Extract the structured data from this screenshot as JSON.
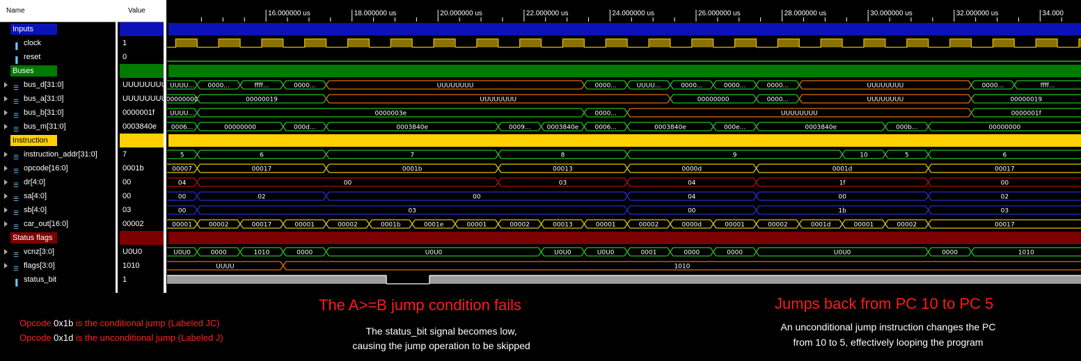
{
  "columns": {
    "name": "Name",
    "value": "Value"
  },
  "timeline": {
    "t0": 13.7,
    "t1": 34.95,
    "ticks": [
      "16.000000 us",
      "18.000000 us",
      "20.000000 us",
      "22.000000 us",
      "24.000000 us",
      "26.000000 us",
      "28.000000 us",
      "30.000000 us",
      "32.000000 us",
      "34.000"
    ],
    "tick_times": [
      16,
      18,
      20,
      22,
      24,
      26,
      28,
      30,
      32,
      34
    ]
  },
  "colors": {
    "inputs": "#0b12b8",
    "buses": "#007a00",
    "instruction": "#ffd000",
    "status": "#7d0000",
    "yellow": "#e6c100",
    "gold": "#c8a020",
    "green": "#21c421",
    "red": "#b01010",
    "blue": "#2030d0",
    "orange": "#e07000",
    "gray": "#9c9c9c",
    "clockFill": "#8a7100"
  },
  "signals": [
    {
      "name": "Inputs",
      "value": "",
      "kind": "group",
      "color": "#0b12b8"
    },
    {
      "name": "clock",
      "value": "1",
      "kind": "bit",
      "icon": "bit-icon"
    },
    {
      "name": "reset",
      "value": "0",
      "kind": "bit",
      "icon": "bit-icon"
    },
    {
      "name": "Buses",
      "value": "",
      "kind": "group",
      "color": "#007a00"
    },
    {
      "name": "bus_d[31:0]",
      "value": "UUUUUUUU",
      "kind": "bus",
      "icon": "bus-icon"
    },
    {
      "name": "bus_a[31:0]",
      "value": "UUUUUUUU",
      "kind": "bus",
      "icon": "bus-icon"
    },
    {
      "name": "bus_b[31:0]",
      "value": "0000001f",
      "kind": "bus",
      "icon": "bus-icon"
    },
    {
      "name": "bus_m[31:0]",
      "value": "0003840e",
      "kind": "bus",
      "icon": "bus-icon"
    },
    {
      "name": "Instruction",
      "value": "",
      "kind": "group",
      "color": "#ffd000"
    },
    {
      "name": "instruction_addr[31:0]",
      "value": "7",
      "kind": "bus",
      "icon": "bus-icon"
    },
    {
      "name": "opcode[16:0]",
      "value": "0001b",
      "kind": "bus",
      "icon": "bus-icon"
    },
    {
      "name": "dr[4:0]",
      "value": "00",
      "kind": "bus",
      "icon": "bus-icon"
    },
    {
      "name": "sa[4:0]",
      "value": "00",
      "kind": "bus",
      "icon": "bus-icon"
    },
    {
      "name": "sb[4:0]",
      "value": "03",
      "kind": "bus",
      "icon": "bus-icon"
    },
    {
      "name": "car_out[16:0]",
      "value": "00002",
      "kind": "bus",
      "icon": "bus-icon"
    },
    {
      "name": "Status flags",
      "value": "",
      "kind": "group",
      "color": "#7d0000"
    },
    {
      "name": "vcnz[3:0]",
      "value": "U0U0",
      "kind": "bus",
      "icon": "bus-icon"
    },
    {
      "name": "flags[3:0]",
      "value": "1010",
      "kind": "bus",
      "icon": "bus-icon"
    },
    {
      "name": "status_bit",
      "value": "1",
      "kind": "bit",
      "icon": "bit-icon"
    }
  ],
  "waves": {
    "bus_d": [
      {
        "t": 13.7,
        "v": "UUUU...",
        "c": "#21c421"
      },
      {
        "t": 14.4,
        "v": "0000...",
        "c": "#21c421"
      },
      {
        "t": 15.4,
        "v": "ffff...",
        "c": "#21c421"
      },
      {
        "t": 16.4,
        "v": "0000...",
        "c": "#21c421"
      },
      {
        "t": 17.4,
        "v": "UUUUUUUU",
        "c": "#e07000"
      },
      {
        "t": 23.4,
        "v": "0000...",
        "c": "#21c421"
      },
      {
        "t": 24.4,
        "v": "UUUU...",
        "c": "#21c421"
      },
      {
        "t": 25.4,
        "v": "0000...",
        "c": "#21c421"
      },
      {
        "t": 26.4,
        "v": "0000...",
        "c": "#21c421"
      },
      {
        "t": 27.4,
        "v": "0000...",
        "c": "#21c421"
      },
      {
        "t": 28.4,
        "v": "UUUUUUUU",
        "c": "#e07000"
      },
      {
        "t": 32.4,
        "v": "0000...",
        "c": "#21c421"
      },
      {
        "t": 33.4,
        "v": "ffff...",
        "c": "#21c421"
      }
    ],
    "bus_a": [
      {
        "t": 13.7,
        "v": "00000000",
        "c": "#21c421"
      },
      {
        "t": 14.4,
        "v": "00000019",
        "c": "#21c421"
      },
      {
        "t": 17.4,
        "v": "UUUUUUUU",
        "c": "#e07000"
      },
      {
        "t": 25.4,
        "v": "00000000",
        "c": "#21c421"
      },
      {
        "t": 27.4,
        "v": "0000...",
        "c": "#21c421"
      },
      {
        "t": 28.4,
        "v": "UUUUUUUU",
        "c": "#e07000"
      },
      {
        "t": 32.4,
        "v": "00000019",
        "c": "#21c421"
      }
    ],
    "bus_b": [
      {
        "t": 13.7,
        "v": "UUUU...",
        "c": "#21c421"
      },
      {
        "t": 14.4,
        "v": "0000003e",
        "c": "#21c421"
      },
      {
        "t": 23.4,
        "v": "0000...",
        "c": "#21c421"
      },
      {
        "t": 24.4,
        "v": "UUUUUUUU",
        "c": "#e07000"
      },
      {
        "t": 32.4,
        "v": "0000001f",
        "c": "#21c421"
      }
    ],
    "bus_m": [
      {
        "t": 13.7,
        "v": "0006...",
        "c": "#21c421"
      },
      {
        "t": 14.4,
        "v": "00000000",
        "c": "#21c421"
      },
      {
        "t": 16.4,
        "v": "000d...",
        "c": "#21c421"
      },
      {
        "t": 17.4,
        "v": "0003840e",
        "c": "#21c421"
      },
      {
        "t": 21.4,
        "v": "0009...",
        "c": "#21c421"
      },
      {
        "t": 22.4,
        "v": "0003840e",
        "c": "#21c421"
      },
      {
        "t": 23.4,
        "v": "0006...",
        "c": "#21c421"
      },
      {
        "t": 24.4,
        "v": "0003840e",
        "c": "#21c421"
      },
      {
        "t": 26.4,
        "v": "000e...",
        "c": "#21c421"
      },
      {
        "t": 27.4,
        "v": "0003840e",
        "c": "#21c421"
      },
      {
        "t": 30.4,
        "v": "000b...",
        "c": "#21c421"
      },
      {
        "t": 31.4,
        "v": "00000000",
        "c": "#21c421"
      }
    ],
    "instruction_addr": [
      {
        "t": 13.7,
        "v": "5",
        "c": "#21c421"
      },
      {
        "t": 14.4,
        "v": "6",
        "c": "#21c421"
      },
      {
        "t": 17.4,
        "v": "7",
        "c": "#21c421"
      },
      {
        "t": 21.4,
        "v": "8",
        "c": "#21c421"
      },
      {
        "t": 24.4,
        "v": "9",
        "c": "#21c421"
      },
      {
        "t": 29.4,
        "v": "10",
        "c": "#21c421"
      },
      {
        "t": 30.4,
        "v": "5",
        "c": "#21c421"
      },
      {
        "t": 31.4,
        "v": "6",
        "c": "#21c421"
      }
    ],
    "opcode": [
      {
        "t": 13.7,
        "v": "00007",
        "c": "#e6c100"
      },
      {
        "t": 14.4,
        "v": "00017",
        "c": "#e6c100"
      },
      {
        "t": 17.4,
        "v": "0001b",
        "c": "#e6c100"
      },
      {
        "t": 21.4,
        "v": "00013",
        "c": "#e6c100"
      },
      {
        "t": 24.4,
        "v": "0000d",
        "c": "#e6c100"
      },
      {
        "t": 27.4,
        "v": "0001d",
        "c": "#e6c100"
      },
      {
        "t": 31.4,
        "v": "00017",
        "c": "#e6c100"
      }
    ],
    "dr": [
      {
        "t": 13.7,
        "v": "04",
        "c": "#b01010"
      },
      {
        "t": 14.4,
        "v": "00",
        "c": "#b01010"
      },
      {
        "t": 21.4,
        "v": "03",
        "c": "#b01010"
      },
      {
        "t": 24.4,
        "v": "04",
        "c": "#b01010"
      },
      {
        "t": 27.4,
        "v": "1f",
        "c": "#b01010"
      },
      {
        "t": 31.4,
        "v": "00",
        "c": "#b01010"
      }
    ],
    "sa": [
      {
        "t": 13.7,
        "v": "00",
        "c": "#2030d0"
      },
      {
        "t": 14.4,
        "v": "02",
        "c": "#2030d0"
      },
      {
        "t": 17.4,
        "v": "00",
        "c": "#2030d0"
      },
      {
        "t": 24.4,
        "v": "04",
        "c": "#2030d0"
      },
      {
        "t": 27.4,
        "v": "00",
        "c": "#2030d0"
      },
      {
        "t": 31.4,
        "v": "02",
        "c": "#2030d0"
      }
    ],
    "sb": [
      {
        "t": 13.7,
        "v": "00",
        "c": "#2030d0"
      },
      {
        "t": 14.4,
        "v": "03",
        "c": "#2030d0"
      },
      {
        "t": 24.4,
        "v": "00",
        "c": "#2030d0"
      },
      {
        "t": 27.4,
        "v": "1b",
        "c": "#2030d0"
      },
      {
        "t": 31.4,
        "v": "03",
        "c": "#2030d0"
      }
    ],
    "car_out": [
      {
        "t": 13.7,
        "v": "00001",
        "c": "#e6c100"
      },
      {
        "t": 14.4,
        "v": "00002",
        "c": "#e6c100"
      },
      {
        "t": 15.4,
        "v": "00017",
        "c": "#e6c100"
      },
      {
        "t": 16.4,
        "v": "00001",
        "c": "#e6c100"
      },
      {
        "t": 17.4,
        "v": "00002",
        "c": "#e6c100"
      },
      {
        "t": 18.4,
        "v": "0001b",
        "c": "#e6c100"
      },
      {
        "t": 19.4,
        "v": "0001e",
        "c": "#e6c100"
      },
      {
        "t": 20.4,
        "v": "00001",
        "c": "#e6c100"
      },
      {
        "t": 21.4,
        "v": "00002",
        "c": "#e6c100"
      },
      {
        "t": 22.4,
        "v": "00013",
        "c": "#e6c100"
      },
      {
        "t": 23.4,
        "v": "00001",
        "c": "#e6c100"
      },
      {
        "t": 24.4,
        "v": "00002",
        "c": "#e6c100"
      },
      {
        "t": 25.4,
        "v": "0000d",
        "c": "#e6c100"
      },
      {
        "t": 26.4,
        "v": "00001",
        "c": "#e6c100"
      },
      {
        "t": 27.4,
        "v": "00002",
        "c": "#e6c100"
      },
      {
        "t": 28.4,
        "v": "0001d",
        "c": "#e6c100"
      },
      {
        "t": 29.4,
        "v": "00001",
        "c": "#e6c100"
      },
      {
        "t": 30.4,
        "v": "00002",
        "c": "#e6c100"
      },
      {
        "t": 31.4,
        "v": "00017",
        "c": "#e6c100"
      }
    ],
    "vcnz": [
      {
        "t": 13.7,
        "v": "U0U0",
        "c": "#21c421"
      },
      {
        "t": 14.4,
        "v": "0000",
        "c": "#21c421"
      },
      {
        "t": 15.4,
        "v": "1010",
        "c": "#21c421"
      },
      {
        "t": 16.4,
        "v": "0000",
        "c": "#21c421"
      },
      {
        "t": 17.4,
        "v": "U0U0",
        "c": "#21c421"
      },
      {
        "t": 22.4,
        "v": "U0U0",
        "c": "#21c421"
      },
      {
        "t": 23.4,
        "v": "U0U0",
        "c": "#21c421"
      },
      {
        "t": 24.4,
        "v": "0001",
        "c": "#21c421"
      },
      {
        "t": 25.4,
        "v": "0000",
        "c": "#21c421"
      },
      {
        "t": 26.4,
        "v": "0000",
        "c": "#21c421"
      },
      {
        "t": 27.4,
        "v": "U0U0",
        "c": "#21c421"
      },
      {
        "t": 31.4,
        "v": "0000",
        "c": "#21c421"
      },
      {
        "t": 32.4,
        "v": "1010",
        "c": "#21c421"
      }
    ],
    "flags": [
      {
        "t": 13.7,
        "v": "UUUU",
        "c": "#e07000"
      },
      {
        "t": 16.4,
        "v": "1010",
        "c": "#e07000"
      }
    ],
    "status_bit": [
      {
        "t": 13.7,
        "v": 1
      },
      {
        "t": 18.8,
        "v": 0
      },
      {
        "t": 19.8,
        "v": 1
      }
    ]
  },
  "annotations": {
    "opcode_jc": {
      "pre": "Opcode ",
      "code": "0x1b",
      "post": " is the conditional jump (Labeled JC)"
    },
    "opcode_j": {
      "pre": "Opcode ",
      "code": "0x1d",
      "post": " is the unconditional jump (Labeled J)"
    },
    "fail_title": "The A>=B jump condition fails",
    "fail_line1": "The status_bit signal becomes low,",
    "fail_line2": "causing the jump operation to be skipped",
    "jump_title": "Jumps back from PC 10 to PC 5",
    "jump_line1": "An unconditional jump instruction changes the PC",
    "jump_line2": "from 10 to 5, effectively looping the program"
  }
}
